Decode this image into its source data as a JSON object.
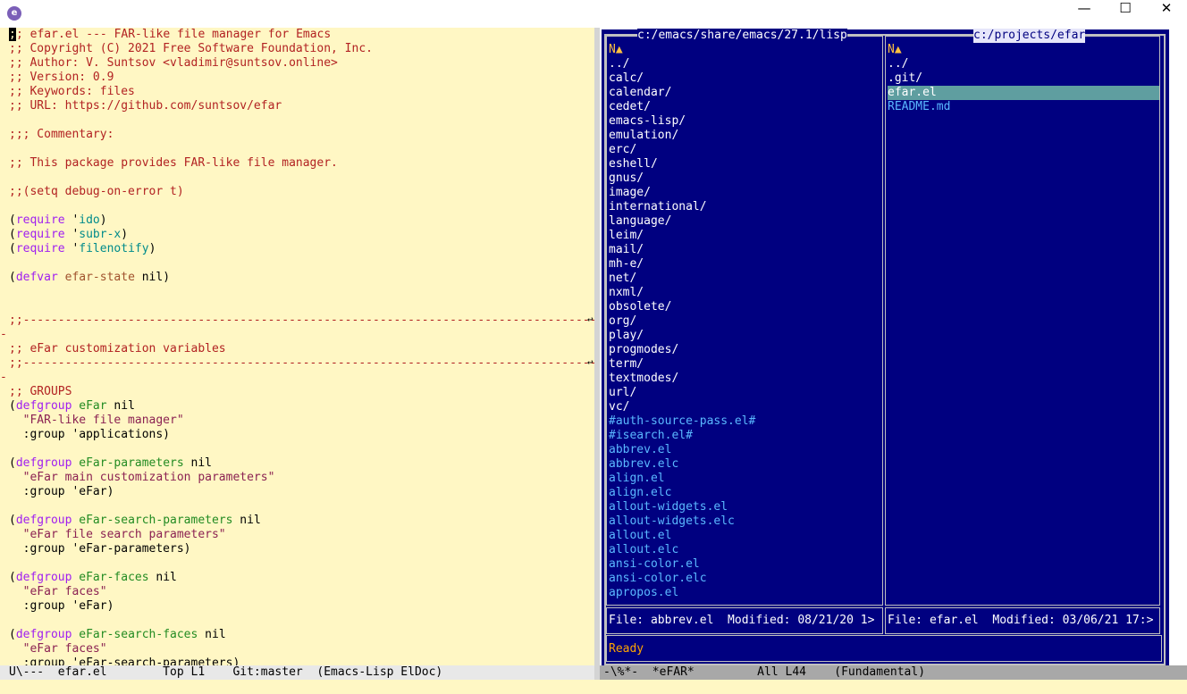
{
  "window": {
    "icon_letter": "e",
    "buttons": {
      "minimize": "—",
      "maximize": "☐",
      "close": "✕"
    }
  },
  "editor": {
    "lines": [
      ";; efar.el --- FAR-like file manager for Emacs",
      ";; Copyright (C) 2021 Free Software Foundation, Inc.",
      ";; Author: V. Suntsov <vladimir@suntsov.online>",
      ";; Version: 0.9",
      ";; Keywords: files",
      ";; URL: https://github.com/suntsov/efar",
      "",
      ";;; Commentary:",
      "",
      ";; This package provides FAR-like file manager.",
      "",
      ";;(setq debug-on-error t)",
      "",
      "(require 'ido)",
      "(require 'subr-x)",
      "(require 'filenotify)",
      "",
      "(defvar efar-state nil)",
      "",
      "",
      ";;-----------------------------------------------------------------------------------",
      "-",
      ";; eFar customization variables",
      ";;-----------------------------------------------------------------------------------",
      "-",
      ";; GROUPS",
      "(defgroup eFar nil",
      "  \"FAR-like file manager\"",
      "  :group 'applications)",
      "",
      "(defgroup eFar-parameters nil",
      "  \"eFar main customization parameters\"",
      "  :group 'eFar)",
      "",
      "(defgroup eFar-search-parameters nil",
      "  \"eFar file search parameters\"",
      "  :group 'eFar-parameters)",
      "",
      "(defgroup eFar-faces nil",
      "  \"eFar faces\"",
      "  :group 'eFar)",
      "",
      "(defgroup eFar-search-faces nil",
      "  \"eFar faces\"",
      "  :group 'eFar-search-parameters)"
    ],
    "modeline": "U\\---  efar.el        Top L1    Git:master  (Emacs-Lisp ElDoc)"
  },
  "efar": {
    "left_panel": {
      "path": "c:/emacs/share/emacs/27.1/lisp",
      "header": "N▲",
      "dirs": [
        "../",
        "calc/",
        "calendar/",
        "cedet/",
        "emacs-lisp/",
        "emulation/",
        "erc/",
        "eshell/",
        "gnus/",
        "image/",
        "international/",
        "language/",
        "leim/",
        "mail/",
        "mh-e/",
        "net/",
        "nxml/",
        "obsolete/",
        "org/",
        "play/",
        "progmodes/",
        "term/",
        "textmodes/",
        "url/",
        "vc/"
      ],
      "files": [
        "#auth-source-pass.el#",
        "#isearch.el#",
        "abbrev.el",
        "abbrev.elc",
        "align.el",
        "align.elc",
        "allout-widgets.el",
        "allout-widgets.elc",
        "allout.el",
        "allout.elc",
        "ansi-color.el",
        "ansi-color.elc",
        "apropos.el"
      ],
      "status": "File: abbrev.el  Modified: 08/21/20 1>"
    },
    "right_panel": {
      "path": "c:/projects/efar",
      "header": "N▲",
      "dirs": [
        "../",
        ".git/"
      ],
      "selected": "efar.el",
      "files": [
        "README.md"
      ],
      "status": "File: efar.el  Modified: 03/06/21 17:>"
    },
    "message": "Ready",
    "modeline": "-\\%*-  *eFAR*         All L44    (Fundamental)"
  },
  "colors": {
    "editor_bg": "#fff7c4",
    "far_bg": "#000080",
    "far_dir": "#ffffff",
    "far_file": "#5ab8ff",
    "far_selected_bg": "#5f9ea0",
    "ready": "#ffa500",
    "active_path_bg": "#e6e6fa",
    "comment": "#b22222",
    "keyword": "#a020f0"
  }
}
